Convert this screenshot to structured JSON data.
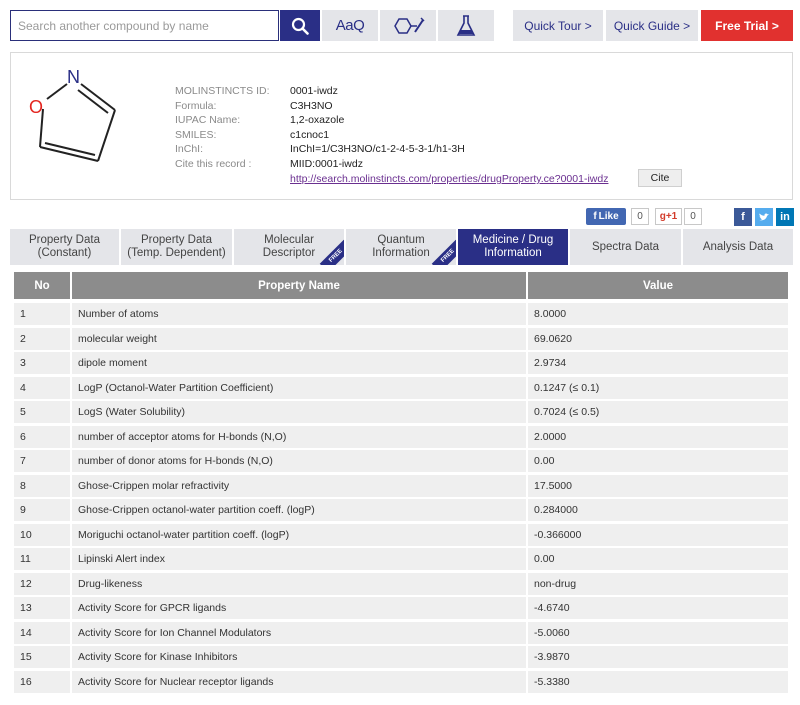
{
  "search": {
    "placeholder": "Search another compound by name"
  },
  "toolbar": {
    "text_search_label": "AaQ",
    "search_icon": "magnifier-icon",
    "structure_icon": "structure-draw-icon",
    "flask_icon": "flask-icon"
  },
  "nav": {
    "quick_tour": "Quick Tour  >",
    "quick_guide": "Quick Guide  >",
    "free_trial": "Free Trial  >"
  },
  "colors": {
    "brand": "#2a2f86",
    "accent_red": "#e1312f",
    "header_gray": "#8c8c8c"
  },
  "compound": {
    "structure_atoms": [
      "O",
      "N"
    ],
    "fields": [
      {
        "label": "MOLINSTINCTS ID:",
        "value": "0001-iwdz"
      },
      {
        "label": "Formula:",
        "value": "C3H3NO"
      },
      {
        "label": "IUPAC Name:",
        "value": "1,2-oxazole"
      },
      {
        "label": "SMILES:",
        "value": "c1cnoc1"
      },
      {
        "label": "InChI:",
        "value": "InChI=1/C3H3NO/c1-2-4-5-3-1/h1-3H"
      },
      {
        "label": "Cite this record :",
        "value": "MIID:0001-iwdz"
      }
    ],
    "cite_url": "http://search.molinstincts.com/properties/drugProperty.ce?0001-iwdz",
    "cite_button": "Cite"
  },
  "social": {
    "like_label": "Like",
    "like_count": "0",
    "gplus_label": "g+1",
    "gplus_count": "0",
    "icons": [
      "facebook-icon",
      "twitter-icon",
      "linkedin-icon"
    ]
  },
  "tabs": [
    {
      "label": "Property Data\n(Constant)",
      "active": false,
      "free": false
    },
    {
      "label": "Property Data\n(Temp. Dependent)",
      "active": false,
      "free": false
    },
    {
      "label": "Molecular\nDescriptor",
      "active": false,
      "free": true
    },
    {
      "label": "Quantum\nInformation",
      "active": false,
      "free": true
    },
    {
      "label": "Medicine / Drug\nInformation",
      "active": true,
      "free": false
    },
    {
      "label": "Spectra Data",
      "active": false,
      "free": false
    },
    {
      "label": "Analysis Data",
      "active": false,
      "free": false
    }
  ],
  "free_badge": "FREE",
  "table": {
    "headers": {
      "no": "No",
      "name": "Property Name",
      "value": "Value"
    },
    "rows": [
      {
        "no": "1",
        "name": "Number of atoms",
        "value": "8.0000"
      },
      {
        "no": "2",
        "name": "molecular weight",
        "value": "69.0620"
      },
      {
        "no": "3",
        "name": "dipole moment",
        "value": "2.9734"
      },
      {
        "no": "4",
        "name": "LogP (Octanol-Water Partition Coefficient)",
        "value": "0.1247 (≤ 0.1)"
      },
      {
        "no": "5",
        "name": "LogS (Water Solubility)",
        "value": "0.7024 (≤ 0.5)"
      },
      {
        "no": "6",
        "name": "number of acceptor atoms for H-bonds (N,O)",
        "value": "2.0000"
      },
      {
        "no": "7",
        "name": "number of donor atoms for H-bonds (N,O)",
        "value": "0.00"
      },
      {
        "no": "8",
        "name": "Ghose-Crippen molar refractivity",
        "value": "17.5000"
      },
      {
        "no": "9",
        "name": "Ghose-Crippen octanol-water partition coeff. (logP)",
        "value": "0.284000"
      },
      {
        "no": "10",
        "name": "Moriguchi octanol-water partition coeff. (logP)",
        "value": "-0.366000"
      },
      {
        "no": "11",
        "name": "Lipinski Alert index",
        "value": "0.00"
      },
      {
        "no": "12",
        "name": "Drug-likeness",
        "value": "non-drug"
      },
      {
        "no": "13",
        "name": "Activity Score for GPCR ligands",
        "value": "-4.6740"
      },
      {
        "no": "14",
        "name": "Activity Score for Ion Channel Modulators",
        "value": "-5.0060"
      },
      {
        "no": "15",
        "name": "Activity Score for Kinase Inhibitors",
        "value": "-3.9870"
      },
      {
        "no": "16",
        "name": "Activity Score for Nuclear receptor ligands",
        "value": "-5.3380"
      }
    ]
  }
}
